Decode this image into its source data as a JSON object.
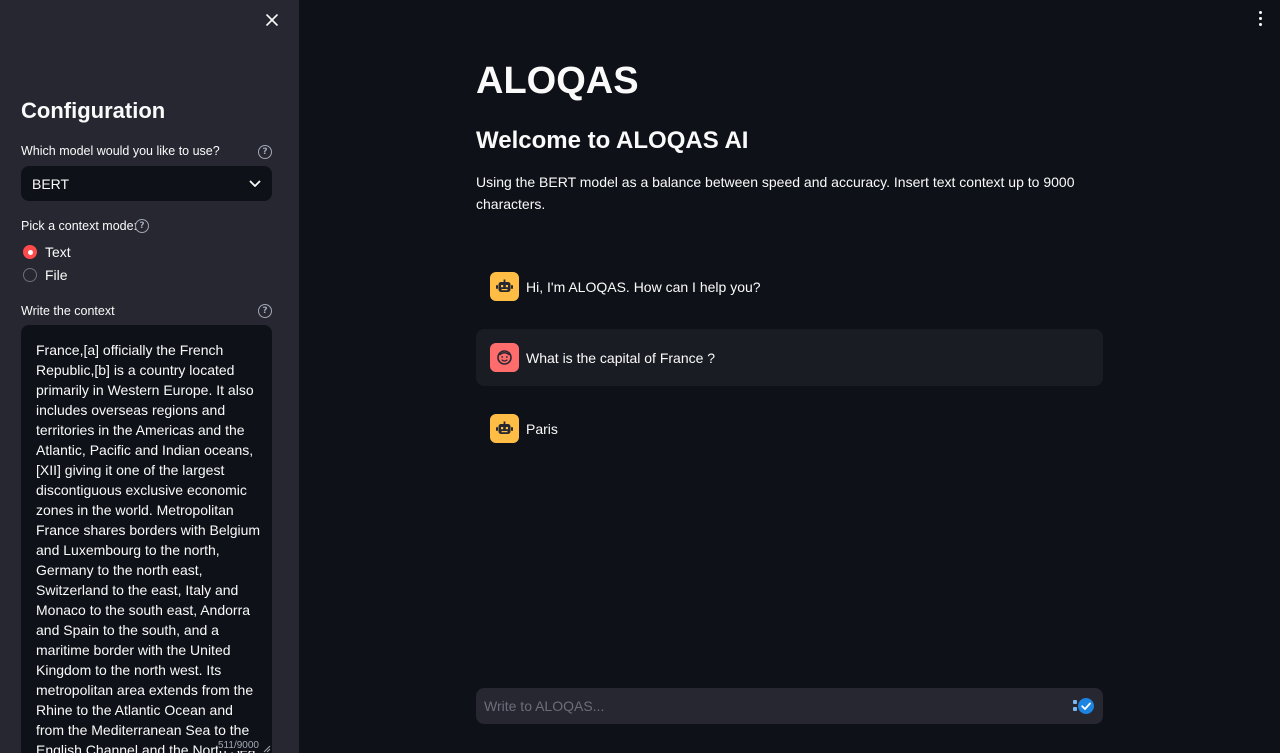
{
  "sidebar": {
    "heading": "Configuration",
    "model_label": "Which model would you like to use?",
    "model_value": "BERT",
    "mode_label": "Pick a context mode:",
    "modes": [
      {
        "label": "Text",
        "selected": true
      },
      {
        "label": "File",
        "selected": false
      }
    ],
    "context_label": "Write the context",
    "context_lines": [
      "France,[a] officially the French",
      "Republic,[b] is a country located",
      "primarily in Western Europe. It also",
      "includes overseas regions and",
      "territories in the Americas and the",
      "Atlantic, Pacific and Indian oceans,",
      "[XII] giving it one of the largest",
      "discontiguous exclusive economic",
      "zones in the world. Metropolitan",
      "France shares borders with Belgium",
      "and Luxembourg to the north,",
      "Germany to the north east,",
      "Switzerland to the east, Italy and",
      "Monaco to the south east, Andorra",
      "and Spain to the south, and a",
      "maritime border with the United",
      "Kingdom to the north west. Its",
      "metropolitan area extends from the",
      "Rhine to the Atlantic Ocean and",
      "from the Mediterranean Sea to the",
      "English Channel and the North Sea;"
    ],
    "char_count": "511/9000"
  },
  "main": {
    "title": "ALOQAS",
    "subtitle": "Welcome to ALOQAS AI",
    "description": "Using the BERT model as a balance between speed and accuracy. Insert text context up to 9000 characters.",
    "messages": [
      {
        "role": "assistant",
        "text": "Hi, I'm ALOQAS. How can I help you?"
      },
      {
        "role": "user",
        "text": "What is the capital of France ?"
      },
      {
        "role": "assistant",
        "text": "Paris"
      }
    ],
    "chat_placeholder": "Write to ALOQAS..."
  },
  "colors": {
    "background": "#0e1117",
    "sidebar": "#262730",
    "accent": "#ff4b4b",
    "bot_avatar": "#ffbd45",
    "user_avatar": "#ff6c6c",
    "send": "#1c83e1"
  },
  "icons": {
    "close": "close-icon",
    "help": "help-icon",
    "chevron": "chevron-down-icon",
    "bot": "robot-icon",
    "user": "user-face-icon",
    "send": "send-icon",
    "menu": "kebab-menu-icon"
  }
}
